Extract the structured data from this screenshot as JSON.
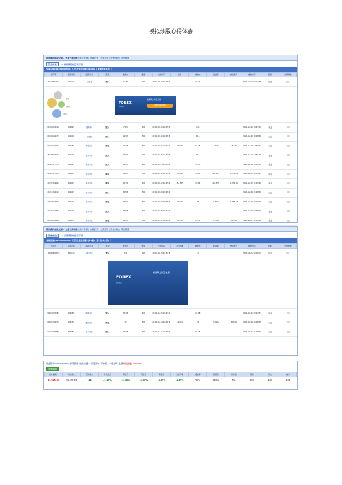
{
  "title": "模拟炒股心得体会",
  "panel1": {
    "header": "我的委托成交记录 - 交易记录明细",
    "header_links": "[ 用户登录  |  交易记录  |  全部查询  |  历史成交  |  持仓明细 ]",
    "ctrl_btn": "历史成交",
    "ctrl_link": "+ 请选择查询日期  下载",
    "subhead": "交易记录(0104080200) 【 历史成交明细: 共13笔 ( 第1页/共1页) 】",
    "columns": [
      "合同号",
      "股票代码",
      "股票名称",
      "买卖",
      "委托价",
      "数量",
      "委托时间",
      "撤销",
      "成交价",
      "收益率",
      "交易盈亏",
      "成交时间",
      "结果",
      "委托状态"
    ],
    "row0": {
      "id": "00104082002",
      "code": "000334",
      "name": "深城业",
      "side": "买入",
      "price": "27.35",
      "qty": "300",
      "time": "2011-12-20 10:46:29",
      "deal": "27.30",
      "dealtime": "2011-12-20 13:07:35",
      "result": "√成交"
    },
    "ad": {
      "lbl1": "盈利",
      "lbl2": "持有",
      "lbl3": "卖出",
      "logo": "FOREX",
      "logosub": "外汇交易",
      "head": "模拟网上外汇交易",
      "cta": "注册免费模拟账户"
    },
    "rows": [
      {
        "id": "00104032702",
        "code": "000025",
        "name": "深万科A",
        "side": "买入",
        "price": "7.05",
        "qty": "300",
        "time": "2011-12-20 10:25:32",
        "cancel": "",
        "deal": "7.05",
        "yield": "",
        "pl": "",
        "dealtime": "2011-12-20 10:27:00",
        "result": "√成交"
      },
      {
        "id": "00108934777",
        "code": "000402",
        "name": "金融街",
        "side": "买入",
        "price": "12.53",
        "qty": "300",
        "time": "2011-12-20 10:28:36",
        "cancel": "",
        "deal": "12.5",
        "yield": "",
        "pl": "",
        "dealtime": "2011-12-20 10:28:36",
        "result": "√成交"
      },
      {
        "id": "00404917392",
        "code": "600489",
        "name": "中金黄金",
        "side": "卖出",
        "price": "21.45",
        "qty": "300",
        "time": "2011-12-20 14:54:17",
        "cancel": "22.329",
        "deal": "21.45",
        "yield": "-3.93%",
        "pl": "-263.60",
        "dealtime": "2011-12-20 14:54:22",
        "result": "√成交"
      },
      {
        "id": "75029893461",
        "code": "600215",
        "name": "东方钽业",
        "side": "买入",
        "price": "32.64",
        "qty": "200",
        "time": "2011-12-15 12:30:58",
        "cancel": "",
        "deal": "32.5",
        "yield": "",
        "pl": "",
        "dealtime": "2011-12-15 12:31:25",
        "result": "√成交"
      },
      {
        "id": "02003477378",
        "code": "600215",
        "name": "东方钽业",
        "side": "买入",
        "price": "34.55",
        "qty": "200",
        "time": "2011-12-13 10:31:07",
        "cancel": "",
        "deal": "34.55",
        "yield": "",
        "pl": "",
        "dealtime": "2011-12-13 10:31:30",
        "result": "√成交"
      },
      {
        "id": "21003477270",
        "code": "600215",
        "name": "东方钽业",
        "side": "卖出",
        "price": "34.85",
        "qty": "300",
        "time": "2011-12-12 10:34:27",
        "cancel": "152.614",
        "deal": "34.85",
        "yield": "-10.10%",
        "pl": "-1,775.42",
        "dealtime": "2011-12-12 10:35:25",
        "result": "√成交"
      },
      {
        "id": "20132384613",
        "code": "600215",
        "name": "东方钽业",
        "side": "卖出",
        "price": "30.72",
        "qty": "300",
        "time": "2011-12-12 11:25:23",
        "cancel": "152.535",
        "deal": "30.84",
        "yield": "-20.32%",
        "pl": "-1,752.00",
        "dealtime": "2011-12-12 11:25:36",
        "result": "√成交"
      },
      {
        "id": "20113384413",
        "code": "600215",
        "name": "东方钽业",
        "side": "买入",
        "price": "31.56",
        "qty": "300",
        "time": "2011-12-09 11:28:29",
        "cancel": "",
        "deal": "",
        "yield": "",
        "pl": "",
        "dealtime": "2011-12-09 11:28:30",
        "result": "√成交"
      },
      {
        "id": "22009537093",
        "code": "600215",
        "name": "东方钽业",
        "side": "卖出",
        "price": "32.69",
        "qty": "300",
        "time": "2011-12-09 09:58:33",
        "cancel": "30.289",
        "deal": "33",
        "yield": "-5.39%",
        "pl": "-1,353.23",
        "dealtime": "2011-12-09 10:00:00",
        "result": "√成交"
      },
      {
        "id": "22029444657",
        "code": "600215",
        "name": "东方钽业",
        "side": "买入",
        "price": "34.55",
        "qty": "300",
        "time": "2011-12-08 10:47:24",
        "cancel": "",
        "deal": "",
        "yield": "",
        "pl": "",
        "dealtime": "2011-12-08 10:48:26",
        "result": "√成交"
      },
      {
        "id": "00104094682",
        "code": "300059",
        "name": "东方财富",
        "side": "卖出",
        "price": "24.53",
        "qty": "300",
        "time": "2011-12-07 12:49:16",
        "cancel": "23.390",
        "deal": "24.55",
        "yield": "4.78%",
        "pl": "335.40",
        "dealtime": "2011-12-07 12:50:16",
        "result": "√成交"
      }
    ]
  },
  "panel2": {
    "header": "我的委托成交记录 - 交易记录明细",
    "header_links": "[ 用户登录  |  交易记录  |  全部查询  |  历史成交  |  持仓明细 ]",
    "ctrl_btn": "历史成交",
    "ctrl_link": "+ 请选择查询日期  下载",
    "subhead": "交易记录(0104080200) 【 历史成交明细: 共3笔 ( 第1页/共1页) 】",
    "columns": [
      "合同号",
      "证券代码",
      "股票名称",
      "买卖",
      "委托价",
      "数量",
      "委托时间",
      "盈亏成本",
      "成交价",
      "收益率",
      "交易盈亏",
      "成交时间",
      "结果",
      "委托状态"
    ],
    "row0": {
      "id": "00002420958",
      "code": "600219",
      "name": "南山铝业",
      "side": "买入",
      "price": "8.9",
      "qty": "200",
      "time": "2011-11-25 12:34:59",
      "deal": "8.9",
      "dealtime": "2011-11-25 12:49:27",
      "result": "√成交"
    },
    "ad": {
      "logo": "FOREX",
      "logosub": "外汇交易",
      "head": "模拟网上外汇交易"
    },
    "rows": [
      {
        "id": "00002925387",
        "code": "600489",
        "name": "中金黄金",
        "side": "买入",
        "price": "23.18",
        "qty": "300",
        "time": "2011-11-25 10:23:13",
        "cancel": "",
        "deal": "23.18",
        "yield": "",
        "pl": "",
        "dealtime": "2011-11-25 10:27:57",
        "result": "√成交"
      },
      {
        "id": "00002384773",
        "code": "600783",
        "name": "鲁信创投",
        "side": "卖出",
        "price": "13",
        "qty": "500",
        "time": "2011-11-24 10:28:36",
        "cancel": "12.474",
        "deal": "13",
        "yield": "4.22%",
        "pl": "263.00",
        "dealtime": "2011-11-24 10:28:38",
        "result": "√成交"
      },
      {
        "id": "07108396583",
        "code": "300059",
        "name": "东方财富",
        "side": "买入",
        "price": "23.36",
        "qty": "300",
        "time": "2011-11-21 11:25:23",
        "cancel": "",
        "deal": "23.35",
        "yield": "",
        "pl": "",
        "dealtime": "2011-11-21 11:28:33",
        "result": "√成交"
      }
    ]
  },
  "panel3": {
    "account": "资金账号(0104080200)",
    "desc": "参与项目: 模拟炒股 — 所属区域: 华中区 | 小组代码: 全部",
    "hl": "初始资金: 100,000",
    "tab": "资金余额",
    "columns": [
      "账户总资产",
      "可用资金",
      "已用资金",
      "持仓盈亏",
      "周盈亏",
      "月盈亏",
      "年盈亏",
      "总盈亏率",
      "成功率",
      "周排名",
      "月排名",
      "排名",
      "今日",
      "总计"
    ],
    "values": [
      "94,505.63",
      "58,037.63",
      "-19",
      "-1.27%",
      "-5.39%",
      "-5.39%",
      "-5.39%",
      "-5.49%",
      "50%",
      "230%",
      "8%",
      "382",
      "-113",
      "488"
    ]
  }
}
